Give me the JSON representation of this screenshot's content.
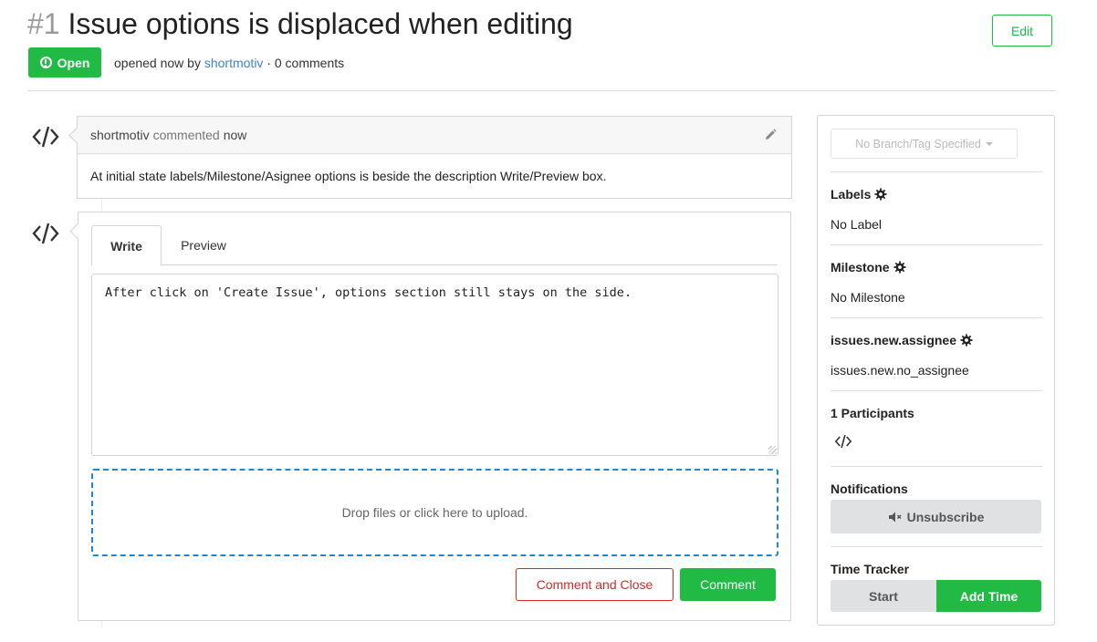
{
  "issue": {
    "number": "#1",
    "title": "Issue options is displaced when editing",
    "status": "Open",
    "meta_prefix": "opened now by",
    "author": "shortmotiv",
    "meta_suffix": "· 0 comments",
    "edit_label": "Edit"
  },
  "comment": {
    "author": "shortmotiv",
    "action": "commented",
    "when": "now",
    "body": "At initial state labels/Milestone/Asignee options is beside the description Write/Preview box."
  },
  "editor": {
    "tab_write": "Write",
    "tab_preview": "Preview",
    "text": "After click on 'Create Issue', options section still stays on the side.",
    "dropzone_text": "Drop files or click here to upload.",
    "close_label": "Comment and Close",
    "comment_label": "Comment"
  },
  "sidebar": {
    "branch_placeholder": "No Branch/Tag Specified",
    "labels_heading": "Labels",
    "labels_value": "No Label",
    "milestone_heading": "Milestone",
    "milestone_value": "No Milestone",
    "assignee_heading": "issues.new.assignee",
    "assignee_value": "issues.new.no_assignee",
    "participants_heading": "1 Participants",
    "notifications_heading": "Notifications",
    "unsubscribe_label": "Unsubscribe",
    "time_tracker_heading": "Time Tracker",
    "start_label": "Start",
    "add_time_label": "Add Time"
  },
  "colors": {
    "green": "#21ba45",
    "red": "#db2828",
    "blue_link": "#4183c4",
    "dropzone_blue": "#2185d0"
  },
  "icons": [
    "alert-icon",
    "code-icon",
    "pencil-icon",
    "gear-icon",
    "mute-icon",
    "caret-down-icon"
  ]
}
